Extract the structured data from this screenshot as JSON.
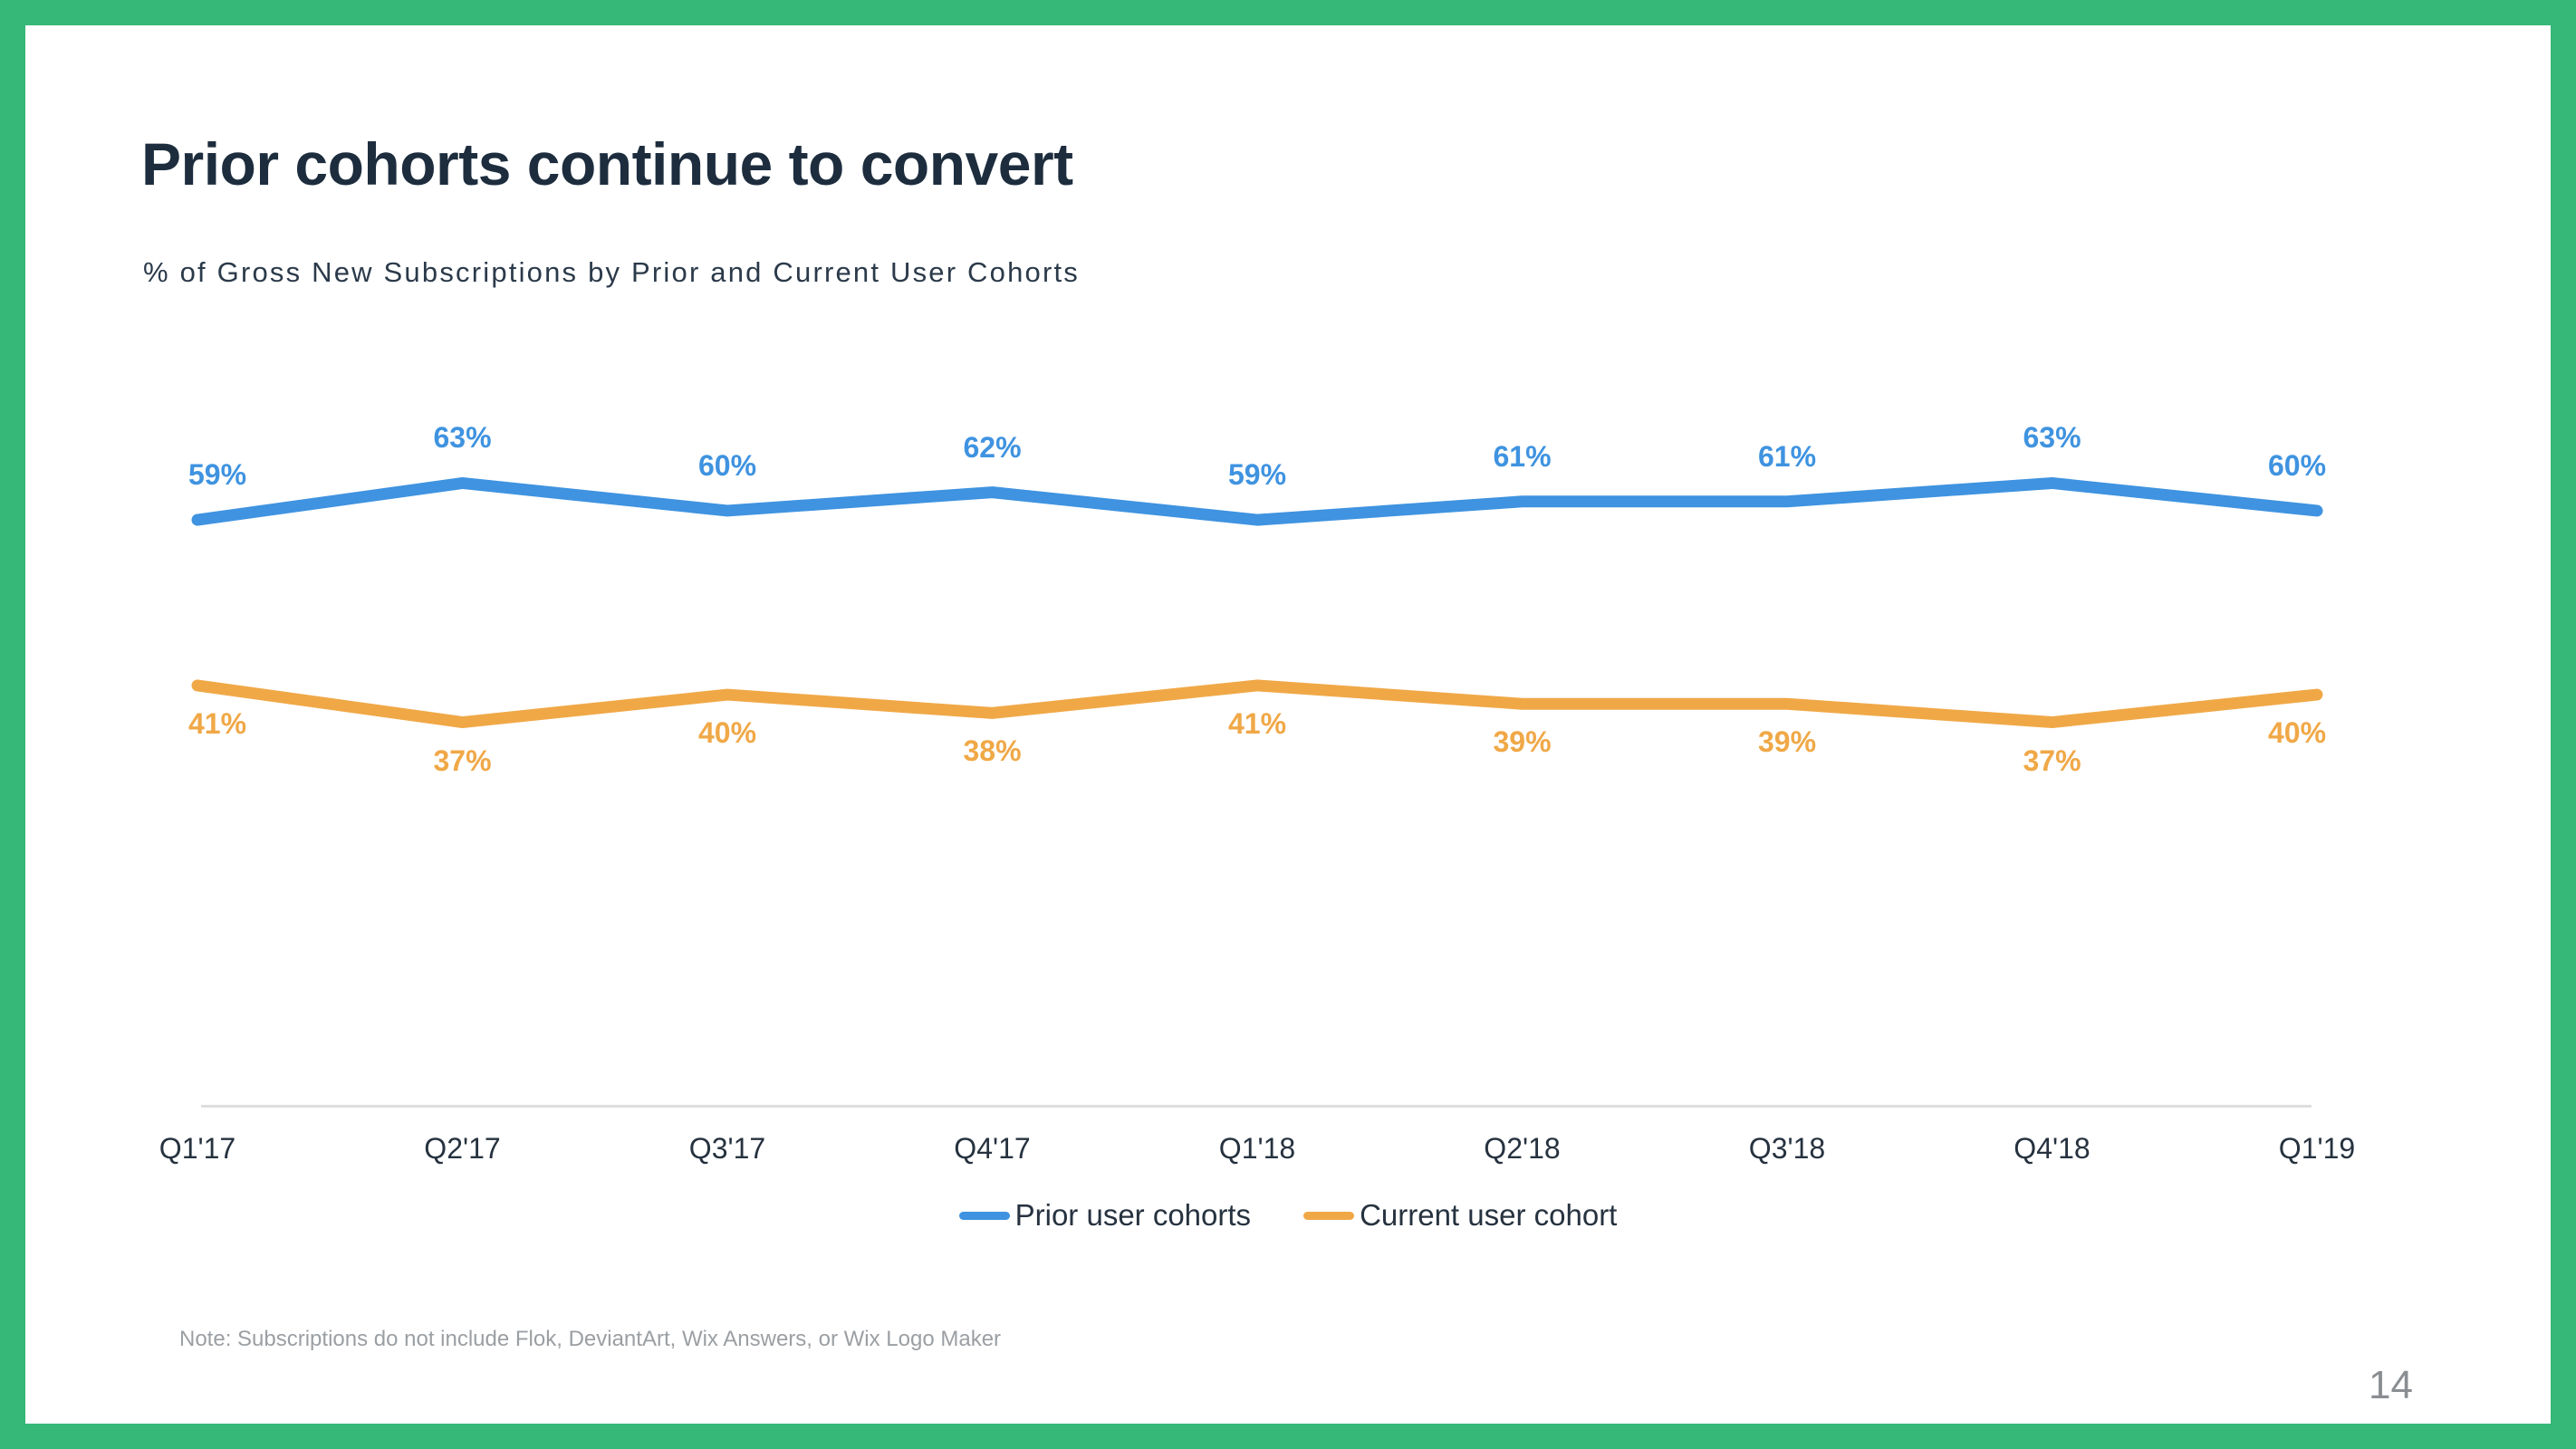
{
  "slide": {
    "title": "Prior cohorts continue to convert",
    "subtitle": "% of Gross New Subscriptions by Prior and Current User Cohorts",
    "note": "Note: Subscriptions do not include Flok, DeviantArt, Wix Answers, or Wix Logo Maker",
    "page_number": "14",
    "border_color": "#35b878",
    "background_color": "#ffffff",
    "title_color": "#1d2d3e"
  },
  "chart_data": {
    "type": "line",
    "title": "Prior cohorts continue to convert",
    "subtitle": "% of Gross New Subscriptions by Prior and Current User Cohorts",
    "xlabel": "",
    "ylabel": "",
    "ylim": [
      0,
      100
    ],
    "grid": false,
    "legend_position": "bottom",
    "categories": [
      "Q1'17",
      "Q2'17",
      "Q3'17",
      "Q4'17",
      "Q1'18",
      "Q2'18",
      "Q3'18",
      "Q4'18",
      "Q1'19"
    ],
    "series": [
      {
        "name": "Prior user cohorts",
        "color": "#3f93e0",
        "label_position": "above",
        "values": [
          59,
          63,
          60,
          62,
          59,
          61,
          61,
          63,
          60
        ],
        "value_labels": [
          "59%",
          "63%",
          "60%",
          "62%",
          "59%",
          "61%",
          "61%",
          "63%",
          "60%"
        ]
      },
      {
        "name": "Current user cohort",
        "color": "#f0a847",
        "label_position": "below",
        "values": [
          41,
          37,
          40,
          38,
          41,
          39,
          39,
          37,
          40
        ],
        "value_labels": [
          "41%",
          "37%",
          "40%",
          "38%",
          "41%",
          "39%",
          "39%",
          "37%",
          "40%"
        ]
      }
    ],
    "legend": [
      {
        "label": "Prior user cohorts",
        "color": "#3f93e0"
      },
      {
        "label": "Current user cohort",
        "color": "#f0a847"
      }
    ]
  }
}
